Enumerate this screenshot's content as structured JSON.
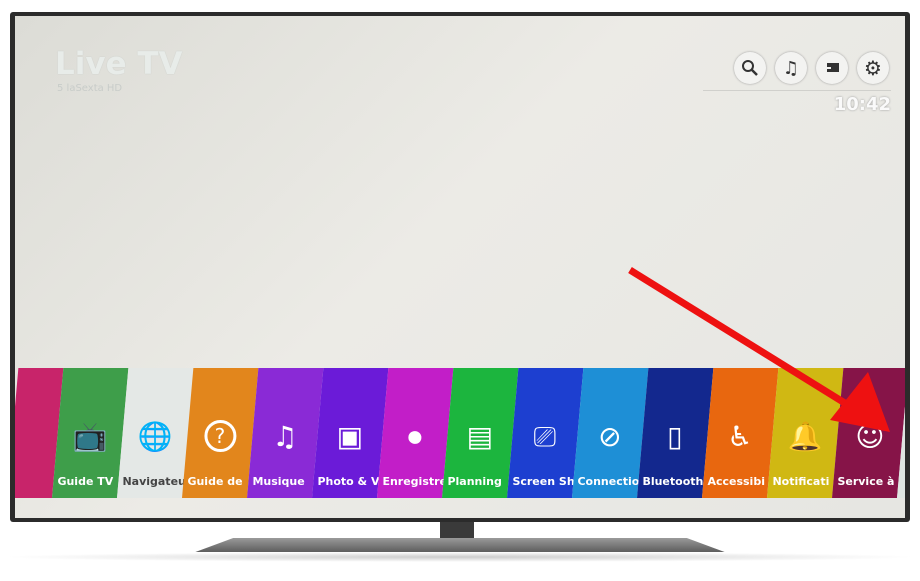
{
  "header": {
    "title": "Live TV",
    "channel": "5 laSexta HD",
    "time": "10:42",
    "buttons": [
      {
        "icon": "search-icon"
      },
      {
        "icon": "music-icon"
      },
      {
        "icon": "input-icon"
      },
      {
        "icon": "settings-icon"
      }
    ]
  },
  "launcher": {
    "tiles": [
      {
        "label": "",
        "color": "#c8246a",
        "icon": ""
      },
      {
        "label": "Guide TV",
        "color": "#3e9e4a",
        "icon": "tv-guide-icon"
      },
      {
        "label": "Navigateu",
        "color": "#e4e8e6",
        "icon": "globe-icon",
        "dark": true
      },
      {
        "label": "Guide de",
        "color": "#e2861c",
        "icon": "help-icon"
      },
      {
        "label": "Musique",
        "color": "#8a2ad6",
        "icon": "music-icon"
      },
      {
        "label": "Photo & V",
        "color": "#6b1bd8",
        "icon": "photo-icon"
      },
      {
        "label": "Enregistre",
        "color": "#c21ec8",
        "icon": "recording-icon"
      },
      {
        "label": "Planning",
        "color": "#1cb53e",
        "icon": "calendar-icon"
      },
      {
        "label": "Screen Sh",
        "color": "#1d3fd0",
        "icon": "screen-share-icon"
      },
      {
        "label": "Connectio",
        "color": "#1e8fd6",
        "icon": "connection-icon"
      },
      {
        "label": "Bluetooth",
        "color": "#13288e",
        "icon": "bluetooth-speaker-icon"
      },
      {
        "label": "Accessibi",
        "color": "#e8670f",
        "icon": "accessibility-icon"
      },
      {
        "label": "Notificati",
        "color": "#d0b813",
        "icon": "notification-icon"
      },
      {
        "label": "Service à",
        "color": "#861448",
        "icon": "lg-support-icon"
      },
      {
        "label": "",
        "color": "#dfe5e2",
        "icon": "edit-icon",
        "dark": true
      }
    ]
  },
  "annotation": {
    "arrow_color": "#ee1111"
  }
}
